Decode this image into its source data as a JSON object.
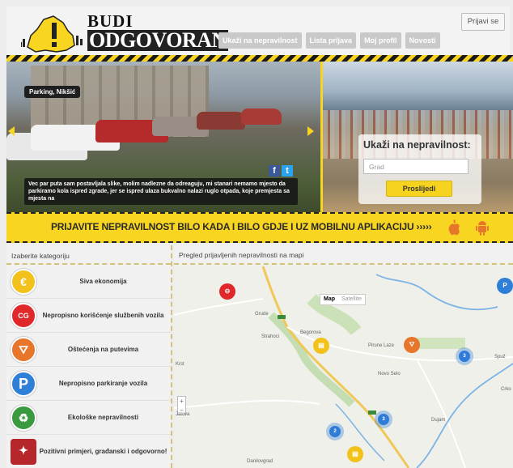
{
  "header": {
    "logo_line1": "BUDI",
    "logo_line2": "ODGOVORAN",
    "nav": [
      "Ukaži na nepravilnost",
      "Lista prijava",
      "Moj profil",
      "Novosti"
    ],
    "login": "Prijavi se"
  },
  "hero": {
    "location": "Parking, Nikšić",
    "caption": "Vec par puta sam postavljala slike, molim nadlezne da odreaguju, mi stanari nemamo mjesto da parkiramo kola ispred zgrade, jer se ispred ulaza bukvalno nalazi ruglo otpada, koje premjesta sa mjesta na",
    "report_title": "Ukaži na nepravilnost:",
    "city_placeholder": "Grad",
    "submit": "Proslijedi"
  },
  "banner": {
    "text": "PRIJAVITE NEPRAVILNOST BILO KADA I BILO GDJE I UZ MOBILNU APLIKACIJU  ›››››"
  },
  "categories": {
    "title": "Izaberite kategoriju",
    "items": [
      {
        "label": "Siva ekonomija",
        "color": "#f3c21a",
        "glyph": "€"
      },
      {
        "label": "Nepropisno korišćenje službenih vozila",
        "color": "#e0282a",
        "glyph": "CG"
      },
      {
        "label": "Oštećenja na putevima",
        "color": "#e8762a",
        "glyph": "⛛"
      },
      {
        "label": "Nepropisno parkiranje vozila",
        "color": "#2f7fd7",
        "glyph": "P"
      },
      {
        "label": "Ekološke nepravilnosti",
        "color": "#3a9a3f",
        "glyph": "♻"
      },
      {
        "label": "Pozitivni primjeri, građanski i odgovorno!",
        "color": "#b5272a",
        "glyph": "✦"
      }
    ]
  },
  "map": {
    "title": "Pregled prijavljenih nepravilnosti na mapi",
    "toggle": [
      "Map",
      "Satellite"
    ],
    "towns": [
      "Grude",
      "Strahoci",
      "Begorova",
      "Pirune Laze",
      "Novo Selo",
      "Spuž",
      "Crko",
      "Dujam",
      "Danilovgrad",
      "Krst",
      "Jalova"
    ],
    "clusters": [
      "3",
      "2",
      "3"
    ]
  }
}
